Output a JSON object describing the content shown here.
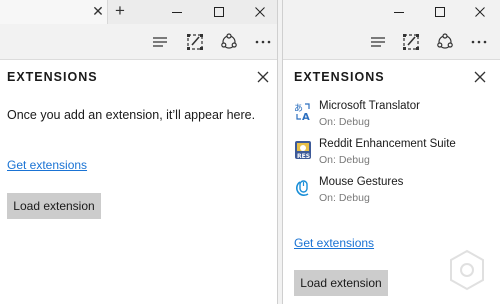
{
  "colors": {
    "link": "#1a73d4",
    "button_bg": "#cccccc",
    "toolbar_bg": "#f2f2f2",
    "status_text": "#7a7a7a",
    "reddit_icon": "#3d5a98",
    "gesture_icon": "#1a8fd8"
  },
  "left_pane": {
    "tab_close_glyph": "✕",
    "new_tab_glyph": "+",
    "panel_title": "EXTENSIONS",
    "close_glyph": "✕",
    "empty_message": "Once you add an extension, it’ll appear here.",
    "get_extensions": "Get extensions",
    "load_extension": "Load extension"
  },
  "right_pane": {
    "panel_title": "EXTENSIONS",
    "extensions": [
      {
        "name": "Microsoft Translator",
        "status": "On: Debug",
        "icon": "translator-icon"
      },
      {
        "name": "Reddit Enhancement Suite",
        "status": "On: Debug",
        "icon": "reddit-enhancement-icon"
      },
      {
        "name": "Mouse Gestures",
        "status": "On: Debug",
        "icon": "mouse-gestures-icon"
      }
    ],
    "get_extensions": "Get extensions",
    "load_extension": "Load extension"
  },
  "toolbar_icons": [
    "hub-icon",
    "web-note-icon",
    "share-icon",
    "more-icon"
  ],
  "window_controls": [
    "minimize-icon",
    "maximize-icon",
    "close-icon"
  ]
}
